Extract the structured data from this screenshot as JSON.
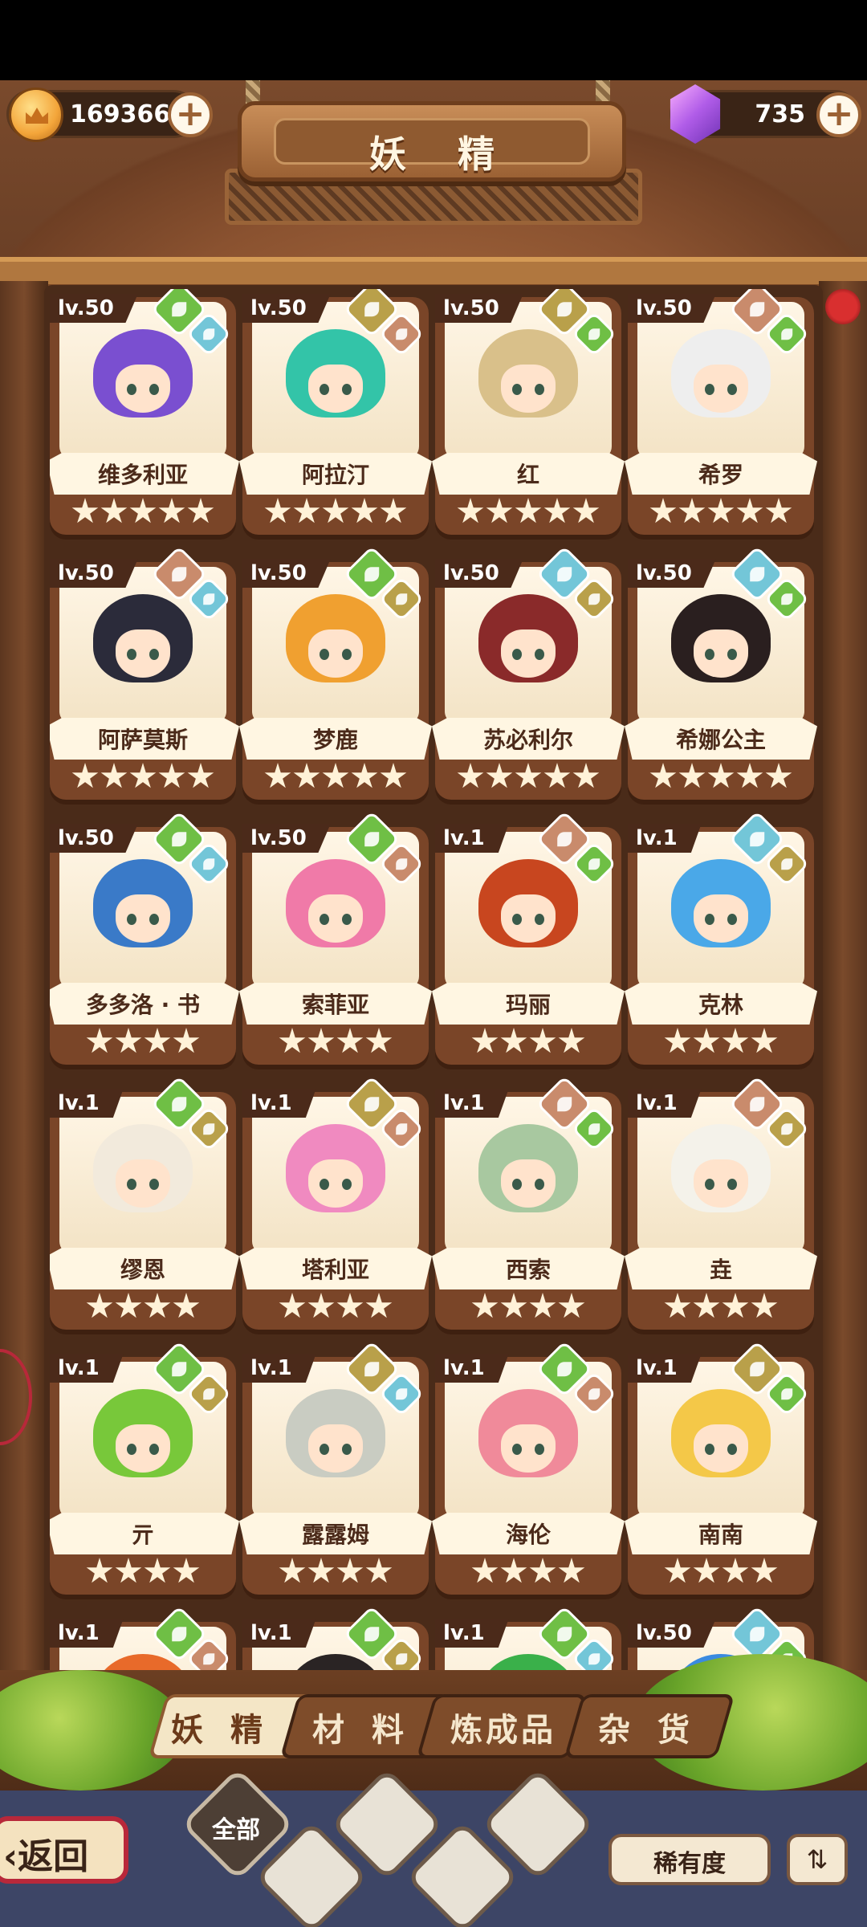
{
  "currency": {
    "gold": {
      "value": "169366",
      "icon": "coin-icon"
    },
    "gem": {
      "value": "735",
      "icon": "gem-icon"
    }
  },
  "header": {
    "title": "妖 精"
  },
  "cards": [
    {
      "level": "lv.50",
      "name": "维多利亚",
      "stars": 5,
      "elements": [
        "leaf",
        "water"
      ],
      "hair": "#7a4fd0"
    },
    {
      "level": "lv.50",
      "name": "阿拉汀",
      "stars": 5,
      "elements": [
        "earth",
        "fire"
      ],
      "hair": "#33c4a8"
    },
    {
      "level": "lv.50",
      "name": "红",
      "stars": 5,
      "elements": [
        "earth",
        "leaf"
      ],
      "hair": "#d9c08a"
    },
    {
      "level": "lv.50",
      "name": "希罗",
      "stars": 5,
      "elements": [
        "fire",
        "leaf"
      ],
      "hair": "#eeeeee"
    },
    {
      "level": "lv.50",
      "name": "阿萨莫斯",
      "stars": 5,
      "elements": [
        "fire",
        "water"
      ],
      "hair": "#2b2b3a"
    },
    {
      "level": "lv.50",
      "name": "梦鹿",
      "stars": 5,
      "elements": [
        "leaf",
        "earth"
      ],
      "hair": "#f0a030"
    },
    {
      "level": "lv.50",
      "name": "苏必利尔",
      "stars": 5,
      "elements": [
        "water",
        "earth"
      ],
      "hair": "#8a2a2a"
    },
    {
      "level": "lv.50",
      "name": "希娜公主",
      "stars": 5,
      "elements": [
        "water",
        "leaf"
      ],
      "hair": "#2a1f1f"
    },
    {
      "level": "lv.50",
      "name": "多多洛 · 书",
      "stars": 4,
      "elements": [
        "leaf",
        "water"
      ],
      "hair": "#3a7ac8"
    },
    {
      "level": "lv.50",
      "name": "索菲亚",
      "stars": 4,
      "elements": [
        "leaf",
        "fire"
      ],
      "hair": "#f07aa8"
    },
    {
      "level": "lv.1",
      "name": "玛丽",
      "stars": 4,
      "elements": [
        "fire",
        "leaf"
      ],
      "hair": "#c8461f"
    },
    {
      "level": "lv.1",
      "name": "克林",
      "stars": 4,
      "elements": [
        "water",
        "earth"
      ],
      "hair": "#4aa8e8"
    },
    {
      "level": "lv.1",
      "name": "缪恩",
      "stars": 4,
      "elements": [
        "leaf",
        "earth"
      ],
      "hair": "#f2eadc"
    },
    {
      "level": "lv.1",
      "name": "塔利亚",
      "stars": 4,
      "elements": [
        "earth",
        "fire"
      ],
      "hair": "#f08ac0"
    },
    {
      "level": "lv.1",
      "name": "西索",
      "stars": 4,
      "elements": [
        "fire",
        "leaf"
      ],
      "hair": "#a8c8a0"
    },
    {
      "level": "lv.1",
      "name": "垚",
      "stars": 4,
      "elements": [
        "fire",
        "earth"
      ],
      "hair": "#f4f2ea"
    },
    {
      "level": "lv.1",
      "name": "亓",
      "stars": 4,
      "elements": [
        "leaf",
        "earth"
      ],
      "hair": "#78c83a"
    },
    {
      "level": "lv.1",
      "name": "露露姆",
      "stars": 4,
      "elements": [
        "earth",
        "water"
      ],
      "hair": "#c9ccc2"
    },
    {
      "level": "lv.1",
      "name": "海伦",
      "stars": 4,
      "elements": [
        "leaf",
        "fire"
      ],
      "hair": "#f08a9a"
    },
    {
      "level": "lv.1",
      "name": "南南",
      "stars": 4,
      "elements": [
        "earth",
        "leaf"
      ],
      "hair": "#f4c848"
    },
    {
      "level": "lv.1",
      "name": "",
      "stars": 0,
      "elements": [
        "leaf",
        "fire"
      ],
      "hair": "#e86a2a"
    },
    {
      "level": "lv.1",
      "name": "",
      "stars": 0,
      "elements": [
        "leaf",
        "earth"
      ],
      "hair": "#2a2424"
    },
    {
      "level": "lv.1",
      "name": "",
      "stars": 0,
      "elements": [
        "leaf",
        "water"
      ],
      "hair": "#3ab04a"
    },
    {
      "level": "lv.50",
      "name": "",
      "stars": 0,
      "elements": [
        "water",
        "leaf"
      ],
      "hair": "#3a8ae0"
    }
  ],
  "tabs": [
    {
      "label": "妖 精",
      "active": true
    },
    {
      "label": "材 料",
      "active": false
    },
    {
      "label": "炼成品",
      "active": false
    },
    {
      "label": "杂 货",
      "active": false
    }
  ],
  "bottom": {
    "back_label": "返回",
    "filter_all_label": "全部",
    "rarity_label": "稀有度",
    "sort_icon": "sort-icon"
  }
}
